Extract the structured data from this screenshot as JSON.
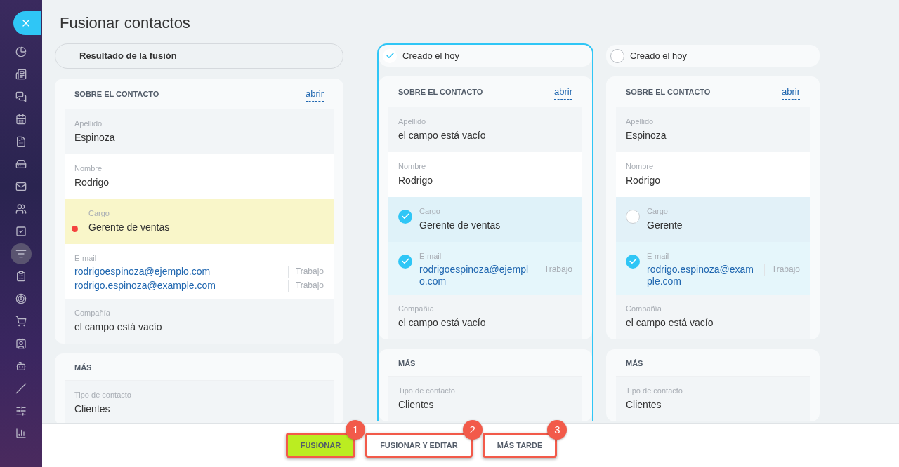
{
  "title": "Fusionar contactos",
  "sidebar": {
    "items": [
      {
        "selected": false
      },
      {
        "selected": false
      },
      {
        "selected": false
      },
      {
        "selected": false
      },
      {
        "selected": false
      },
      {
        "selected": false
      },
      {
        "selected": false
      },
      {
        "selected": false
      },
      {
        "selected": false
      },
      {
        "selected": true
      },
      {
        "selected": false
      },
      {
        "selected": false
      },
      {
        "selected": false
      },
      {
        "selected": false
      },
      {
        "selected": false
      },
      {
        "selected": false
      },
      {
        "selected": false
      },
      {
        "selected": false
      }
    ]
  },
  "columns": [
    {
      "kind": "result",
      "header": "Resultado de la fusión",
      "sections": [
        {
          "title": "SOBRE EL CONTACTO",
          "link": "abrir",
          "fields": [
            {
              "kind": "plain",
              "label": "Apellido",
              "values": [
                {
                  "text": "Espinoza"
                }
              ]
            },
            {
              "kind": "plain",
              "label": "Nombre",
              "values": [
                {
                  "text": "Rodrigo"
                }
              ]
            },
            {
              "kind": "conflict",
              "label": "Cargo",
              "values": [
                {
                  "text": "Gerente de ventas"
                }
              ]
            },
            {
              "kind": "plain",
              "label": "E-mail",
              "values": [
                {
                  "text": "rodrigoespinoza@ejemplo.com",
                  "type": "Trabajo"
                },
                {
                  "text": "rodrigo.espinoza@example.com",
                  "type": "Trabajo"
                }
              ]
            },
            {
              "kind": "plain",
              "label": "Compañía",
              "values": [
                {
                  "text": "el campo está vacío"
                }
              ]
            }
          ]
        },
        {
          "title": "MÁS",
          "fields": [
            {
              "kind": "plain",
              "label": "Tipo de contacto",
              "values": [
                {
                  "text": "Clientes"
                }
              ]
            }
          ]
        }
      ]
    },
    {
      "kind": "candidate",
      "header": "Creado el hoy",
      "selected": true,
      "sections": [
        {
          "title": "SOBRE EL CONTACTO",
          "link": "abrir",
          "fields": [
            {
              "kind": "plain",
              "label": "Apellido",
              "values": [
                {
                  "text": "el campo está vacío"
                }
              ]
            },
            {
              "kind": "plain",
              "label": "Nombre",
              "values": [
                {
                  "text": "Rodrigo"
                }
              ]
            },
            {
              "kind": "choice",
              "selected": true,
              "label": "Cargo",
              "values": [
                {
                  "text": "Gerente de ventas"
                }
              ]
            },
            {
              "kind": "choice",
              "selected": true,
              "label": "E-mail",
              "values": [
                {
                  "text": "rodrigoespinoza@ejemplo.com",
                  "type": "Trabajo"
                }
              ]
            },
            {
              "kind": "plain",
              "label": "Compañía",
              "values": [
                {
                  "text": "el campo está vacío"
                }
              ]
            }
          ]
        },
        {
          "title": "MÁS",
          "fields": [
            {
              "kind": "plain",
              "label": "Tipo de contacto",
              "values": [
                {
                  "text": "Clientes"
                }
              ]
            }
          ]
        }
      ]
    },
    {
      "kind": "candidate",
      "header": "Creado el hoy",
      "selected": false,
      "sections": [
        {
          "title": "SOBRE EL CONTACTO",
          "link": "abrir",
          "fields": [
            {
              "kind": "plain",
              "label": "Apellido",
              "values": [
                {
                  "text": "Espinoza"
                }
              ]
            },
            {
              "kind": "plain",
              "label": "Nombre",
              "values": [
                {
                  "text": "Rodrigo"
                }
              ]
            },
            {
              "kind": "choice",
              "selected": false,
              "label": "Cargo",
              "values": [
                {
                  "text": "Gerente"
                }
              ]
            },
            {
              "kind": "choice",
              "selected": true,
              "label": "E-mail",
              "values": [
                {
                  "text": "rodrigo.espinoza@example.com",
                  "type": "Trabajo"
                }
              ]
            },
            {
              "kind": "plain",
              "label": "Compañía",
              "values": [
                {
                  "text": "el campo está vacío"
                }
              ]
            }
          ]
        },
        {
          "title": "MÁS",
          "fields": [
            {
              "kind": "plain",
              "label": "Tipo de contacto",
              "values": [
                {
                  "text": "Clientes"
                }
              ]
            }
          ]
        }
      ]
    }
  ],
  "buttons": [
    {
      "kind": "primary",
      "label": "FUSIONAR",
      "callout": "1"
    },
    {
      "kind": "secondary",
      "label": "FUSIONAR Y EDITAR",
      "callout": "2"
    },
    {
      "kind": "secondary",
      "label": "MÁS TARDE",
      "callout": "3"
    }
  ]
}
